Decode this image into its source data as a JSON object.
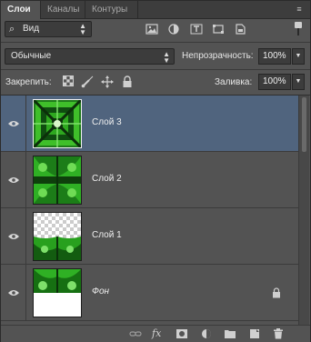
{
  "tabs": [
    {
      "label": "Слои",
      "active": true
    },
    {
      "label": "Каналы",
      "active": false
    },
    {
      "label": "Контуры",
      "active": false
    }
  ],
  "panel_menu_icon": "panel-menu-icon",
  "filter": {
    "kind_label": "Вид",
    "icons": [
      "image-filter-icon",
      "adjustment-filter-icon",
      "type-filter-icon",
      "shape-filter-icon",
      "smart-object-filter-icon"
    ]
  },
  "blend": {
    "mode": "Обычные",
    "opacity_label": "Непрозрачность:",
    "opacity_value": "100%"
  },
  "lock": {
    "label": "Закрепить:",
    "icons": [
      "lock-transparent-icon",
      "lock-image-icon",
      "lock-position-icon",
      "lock-all-icon"
    ],
    "fill_label": "Заливка:",
    "fill_value": "100%"
  },
  "layers": [
    {
      "name": "Слой 3",
      "visible": true,
      "selected": true,
      "locked": false,
      "italic": false
    },
    {
      "name": "Слой 2",
      "visible": true,
      "selected": false,
      "locked": false,
      "italic": false
    },
    {
      "name": "Слой 1",
      "visible": true,
      "selected": false,
      "locked": false,
      "italic": false
    },
    {
      "name": "Фон",
      "visible": true,
      "selected": false,
      "locked": true,
      "italic": true
    }
  ],
  "bottom_icons": [
    "link-layers-icon",
    "fx-icon",
    "add-mask-icon",
    "adjustment-layer-icon",
    "new-group-icon",
    "new-layer-icon",
    "trash-icon"
  ],
  "bottom_fx_label": "fx",
  "colors": {
    "panel_bg": "#535353",
    "selected_row": "#50647e",
    "field_bg": "#3c3c3c"
  }
}
